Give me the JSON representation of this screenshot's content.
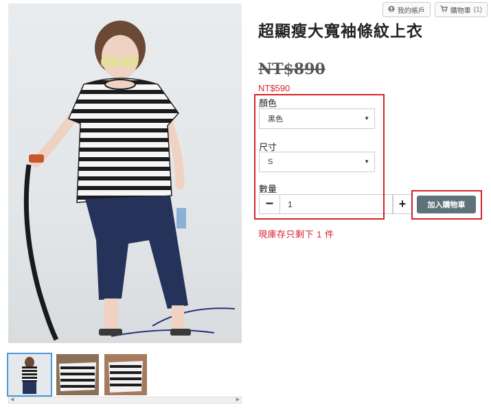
{
  "header": {
    "account_label": "我的帳戶",
    "cart_label": "購物車",
    "cart_count": "(1)"
  },
  "product": {
    "title": "超顯瘦大寬袖條紋上衣",
    "original_price": "NT$890",
    "sale_price": "NT$590",
    "stock_notice": "現庫存只剩下 1 件"
  },
  "options": {
    "color_label": "顏色",
    "color_value": "黑色",
    "size_label": "尺寸",
    "size_value": "S",
    "quantity_label": "數量",
    "quantity_value": "1"
  },
  "actions": {
    "add_to_cart": "加入購物車",
    "minus": "−",
    "plus": "+"
  },
  "colors": {
    "accent_red": "#d9232d",
    "cart_button": "#5e7379",
    "thumb_active_border": "#4a9ad9"
  }
}
